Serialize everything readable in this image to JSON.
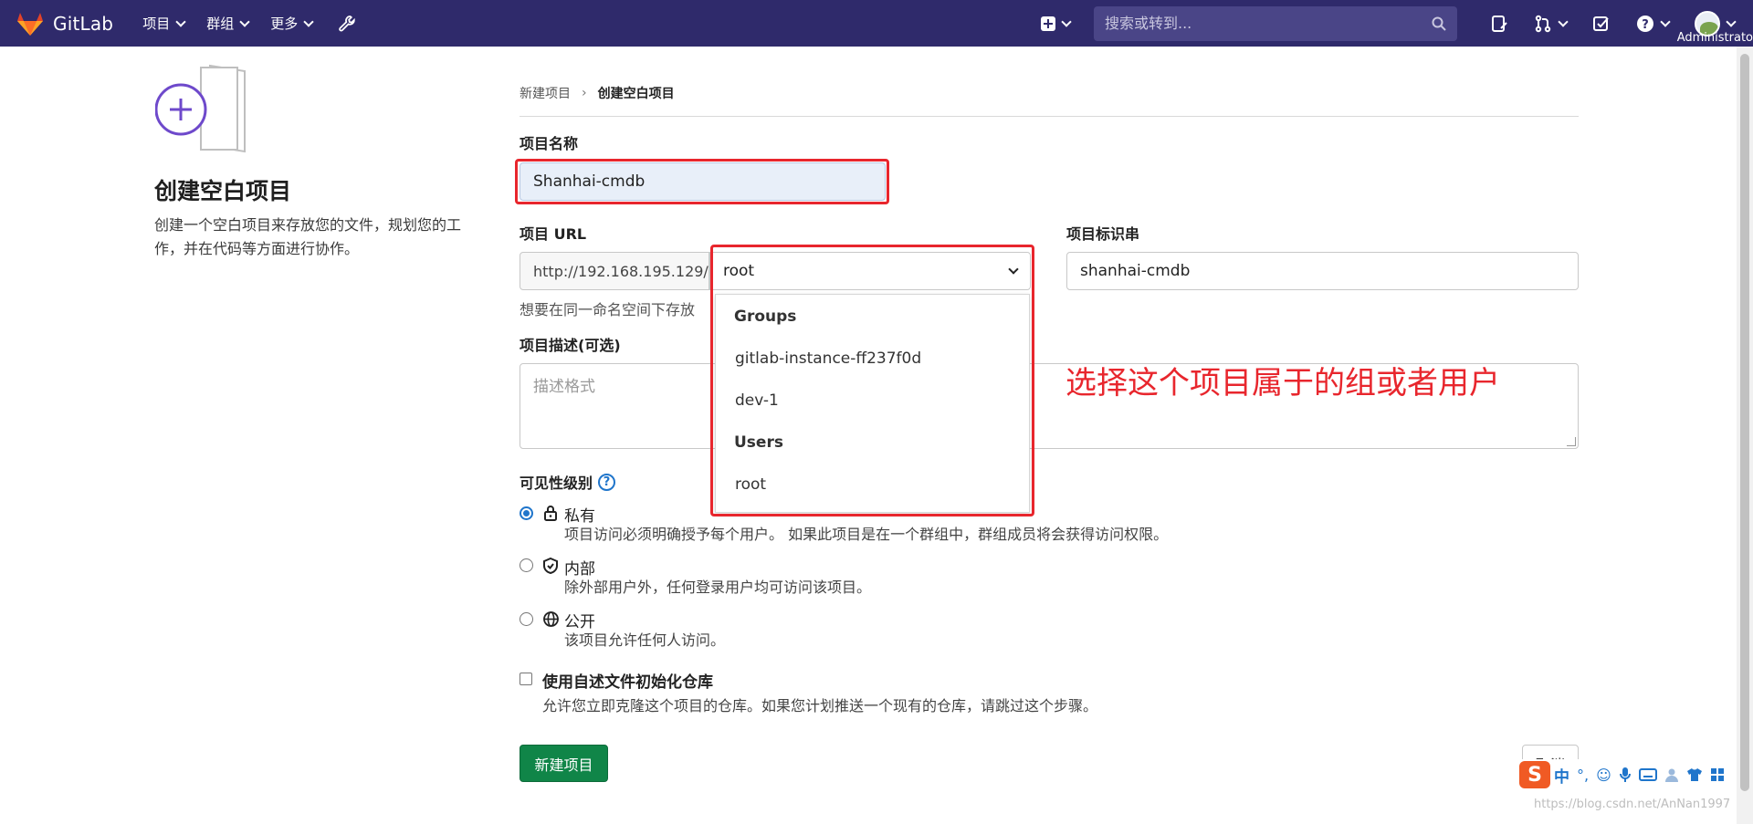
{
  "navbar": {
    "brand": "GitLab",
    "menu": [
      {
        "label": "项目"
      },
      {
        "label": "群组"
      },
      {
        "label": "更多"
      }
    ],
    "search_placeholder": "搜索或转到...",
    "user": "Administrato"
  },
  "left": {
    "title": "创建空白项目",
    "description": "创建一个空白项目来存放您的文件，规划您的工作，并在代码等方面进行协作。"
  },
  "breadcrumb": {
    "parent": "新建项目",
    "current": "创建空白项目"
  },
  "form": {
    "name_label": "项目名称",
    "name_value": "Shanhai-cmdb",
    "url_label": "项目 URL",
    "url_prefix": "http://192.168.195.129/",
    "namespace_value": "root",
    "slug_label": "项目标识串",
    "slug_value": "shanhai-cmdb",
    "url_help": "想要在同一命名空间下存放",
    "description_label": "项目描述(可选)",
    "description_placeholder": "描述格式"
  },
  "dropdown": {
    "groups_header": "Groups",
    "groups": [
      "gitlab-instance-ff237f0d",
      "dev-1"
    ],
    "users_header": "Users",
    "users": [
      "root"
    ]
  },
  "annotation": "选择这个项目属于的组或者用户",
  "visibility": {
    "label": "可见性级别",
    "help": "?",
    "options": [
      {
        "title": "私有",
        "desc": "项目访问必须明确授予每个用户。 如果此项目是在一个群组中，群组成员将会获得访问权限。",
        "checked": true,
        "icon": "lock-icon"
      },
      {
        "title": "内部",
        "desc": "除外部用户外，任何登录用户均可访问该项目。",
        "checked": false,
        "icon": "shield-icon"
      },
      {
        "title": "公开",
        "desc": "该项目允许任何人访问。",
        "checked": false,
        "icon": "globe-icon"
      }
    ]
  },
  "readme": {
    "label": "使用自述文件初始化仓库",
    "desc": "允许您立即克隆这个项目的仓库。如果您计划推送一个现有的仓库，请跳过这个步骤。",
    "checked": false
  },
  "buttons": {
    "create": "新建项目",
    "cancel": "取消"
  },
  "ime": {
    "logo": "S",
    "lang": "中",
    "punct": "°,"
  },
  "watermark": "https://blog.csdn.net/AnNan1997",
  "colors": {
    "navbar": "#2f2a6b",
    "accent": "#1f75cb",
    "primary_button": "#108548",
    "annotation": "#e8262d"
  }
}
